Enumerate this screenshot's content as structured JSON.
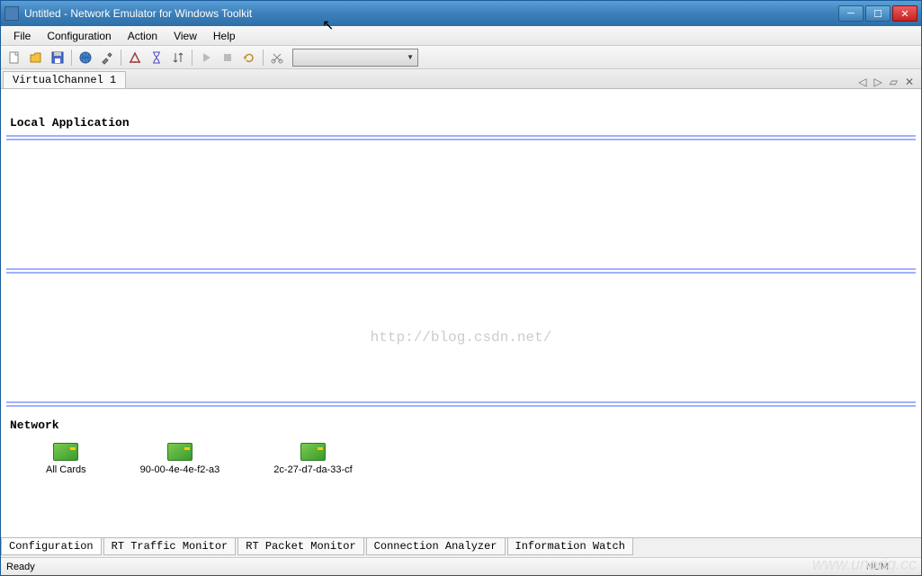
{
  "window": {
    "title": "Untitled - Network Emulator for Windows Toolkit",
    "controls": {
      "min": "─",
      "max": "☐",
      "close": "✕"
    }
  },
  "menubar": [
    "File",
    "Configuration",
    "Action",
    "View",
    "Help"
  ],
  "toolbar": {
    "items": [
      {
        "name": "new-icon"
      },
      {
        "name": "open-icon"
      },
      {
        "name": "save-icon"
      },
      {
        "sep": true
      },
      {
        "name": "globe-icon"
      },
      {
        "name": "tools-icon"
      },
      {
        "sep": true
      },
      {
        "name": "delta-icon"
      },
      {
        "name": "hourglass-icon"
      },
      {
        "name": "sort-icon"
      },
      {
        "sep": true
      },
      {
        "name": "play-icon"
      },
      {
        "name": "stop-icon"
      },
      {
        "name": "refresh-icon"
      },
      {
        "sep": true
      },
      {
        "name": "cut-icon"
      }
    ],
    "combo_value": ""
  },
  "doc_tabs": {
    "active": "VirtualChannel 1",
    "ctrls": [
      "◁",
      "▷",
      "▱",
      "✕"
    ]
  },
  "content": {
    "local_app_header": "Local Application",
    "network_header": "Network",
    "watermark": "http://blog.csdn.net/",
    "network_items": [
      {
        "label": "All Cards"
      },
      {
        "label": "90-00-4e-4e-f2-a3"
      },
      {
        "label": "2c-27-d7-da-33-cf"
      }
    ]
  },
  "bottom_tabs": [
    "Configuration",
    "RT Traffic Monitor",
    "RT Packet Monitor",
    "Connection Analyzer",
    "Information Watch"
  ],
  "statusbar": {
    "left": "Ready",
    "right": "NUM"
  },
  "overlay": {
    "wm2": "www.unorig.cc"
  }
}
